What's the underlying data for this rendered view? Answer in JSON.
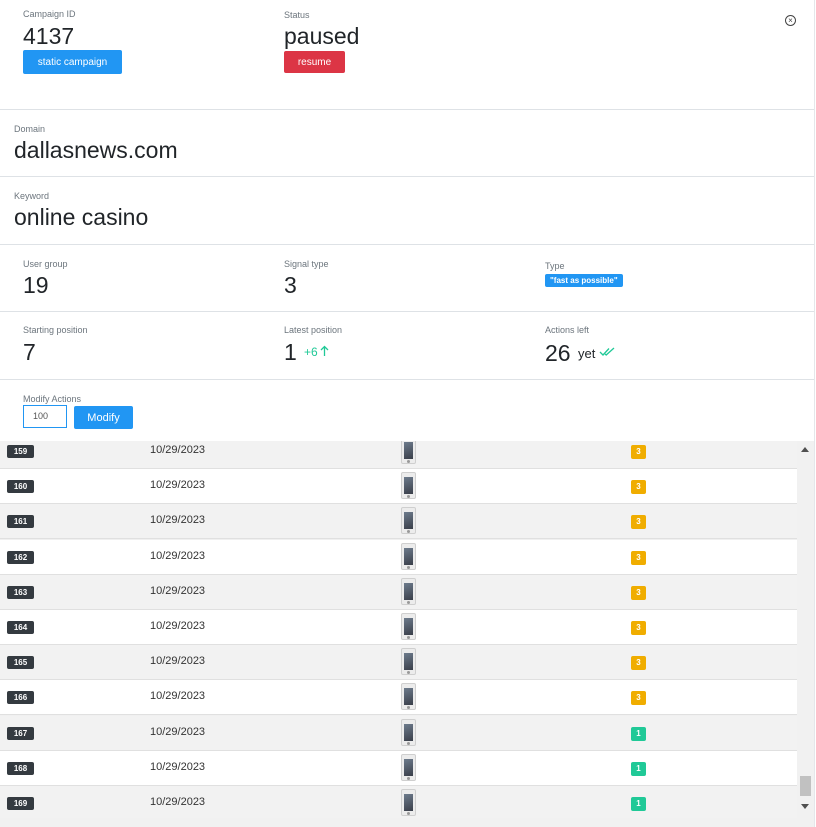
{
  "header": {
    "campaign_id_label": "Campaign ID",
    "campaign_id": "4137",
    "campaign_type_button": "static campaign",
    "status_label": "Status",
    "status": "paused",
    "resume_button": "resume",
    "close_symbol": "×"
  },
  "domain": {
    "label": "Domain",
    "value": "dallasnews.com"
  },
  "keyword": {
    "label": "Keyword",
    "value": "online casino"
  },
  "stats1": {
    "user_group_label": "User group",
    "user_group": "19",
    "signal_type_label": "Signal type",
    "signal_type": "3",
    "type_label": "Type",
    "type_value": "\"fast as possible\""
  },
  "stats2": {
    "starting_position_label": "Starting position",
    "starting_position": "7",
    "latest_position_label": "Latest position",
    "latest_position": "1",
    "position_change": "+6",
    "actions_left_label": "Actions left",
    "actions_left": "26",
    "actions_left_suffix": "yet"
  },
  "modify": {
    "label": "Modify Actions",
    "input_value": "100",
    "button": "Modify"
  },
  "colors": {
    "accent": "#2196f3",
    "danger": "#dc3545",
    "success": "#20c997",
    "warning": "#f0ad00",
    "dark_badge": "#343a40"
  },
  "icons": {
    "close": "close-circle-icon",
    "up_arrow": "arrow-up-icon",
    "check": "double-check-icon",
    "device": "phone-icon"
  },
  "table": {
    "rows": [
      {
        "id": "159",
        "date": "10/29/2023",
        "signal": "3"
      },
      {
        "id": "160",
        "date": "10/29/2023",
        "signal": "3"
      },
      {
        "id": "161",
        "date": "10/29/2023",
        "signal": "3"
      },
      {
        "id": "162",
        "date": "10/29/2023",
        "signal": "3"
      },
      {
        "id": "163",
        "date": "10/29/2023",
        "signal": "3"
      },
      {
        "id": "164",
        "date": "10/29/2023",
        "signal": "3"
      },
      {
        "id": "165",
        "date": "10/29/2023",
        "signal": "3"
      },
      {
        "id": "166",
        "date": "10/29/2023",
        "signal": "3"
      },
      {
        "id": "167",
        "date": "10/29/2023",
        "signal": "1"
      },
      {
        "id": "168",
        "date": "10/29/2023",
        "signal": "1"
      },
      {
        "id": "169",
        "date": "10/29/2023",
        "signal": "1"
      }
    ]
  }
}
